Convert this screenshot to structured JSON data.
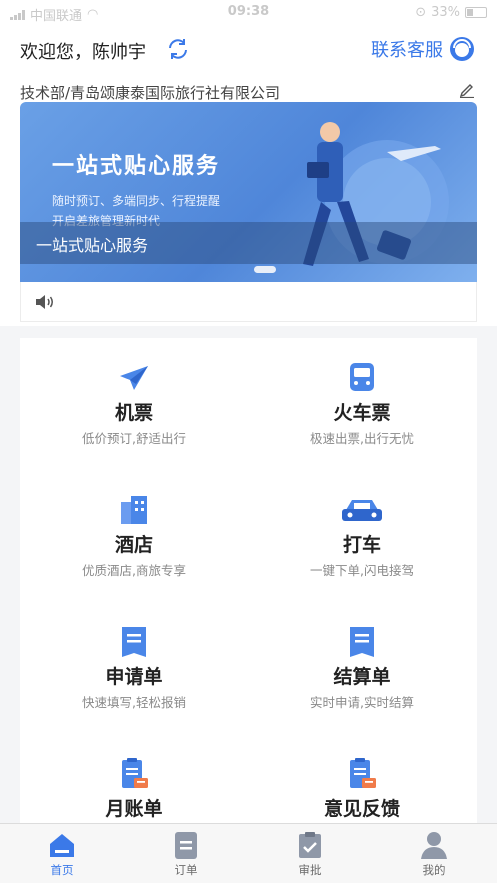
{
  "status_bar": {
    "carrier": "中国联通",
    "time": "09:38",
    "battery": "33%"
  },
  "header": {
    "greeting": "欢迎您，陈帅宇",
    "contact_label": "联系客服",
    "company": "技术部/青岛颂康泰国际旅行社有限公司"
  },
  "banner": {
    "headline": "一站式贴心服务",
    "line1": "随时预订、多端同步、行程提醒",
    "line2": "开启差旅管理新时代",
    "caption": "一站式贴心服务"
  },
  "services": [
    {
      "name": "机票",
      "desc": "低价预订,舒适出行",
      "icon": "airplane-icon"
    },
    {
      "name": "火车票",
      "desc": "极速出票,出行无忧",
      "icon": "train-icon"
    },
    {
      "name": "酒店",
      "desc": "优质酒店,商旅专享",
      "icon": "hotel-icon"
    },
    {
      "name": "打车",
      "desc": "一键下单,闪电接驾",
      "icon": "car-icon"
    },
    {
      "name": "申请单",
      "desc": "快速填写,轻松报销",
      "icon": "document-icon"
    },
    {
      "name": "结算单",
      "desc": "实时申请,实时结算",
      "icon": "document-icon"
    },
    {
      "name": "月账单",
      "desc": "",
      "icon": "bill-icon"
    },
    {
      "name": "意见反馈",
      "desc": "",
      "icon": "feedback-icon"
    }
  ],
  "tabs": [
    {
      "label": "首页",
      "icon": "home-icon",
      "active": true
    },
    {
      "label": "订单",
      "icon": "order-icon",
      "active": false
    },
    {
      "label": "审批",
      "icon": "approval-icon",
      "active": false
    },
    {
      "label": "我的",
      "icon": "profile-icon",
      "active": false
    }
  ],
  "colors": {
    "accent": "#3b79e8",
    "banner": "#5a8fdd",
    "icon_blue": "#4a86e8"
  }
}
